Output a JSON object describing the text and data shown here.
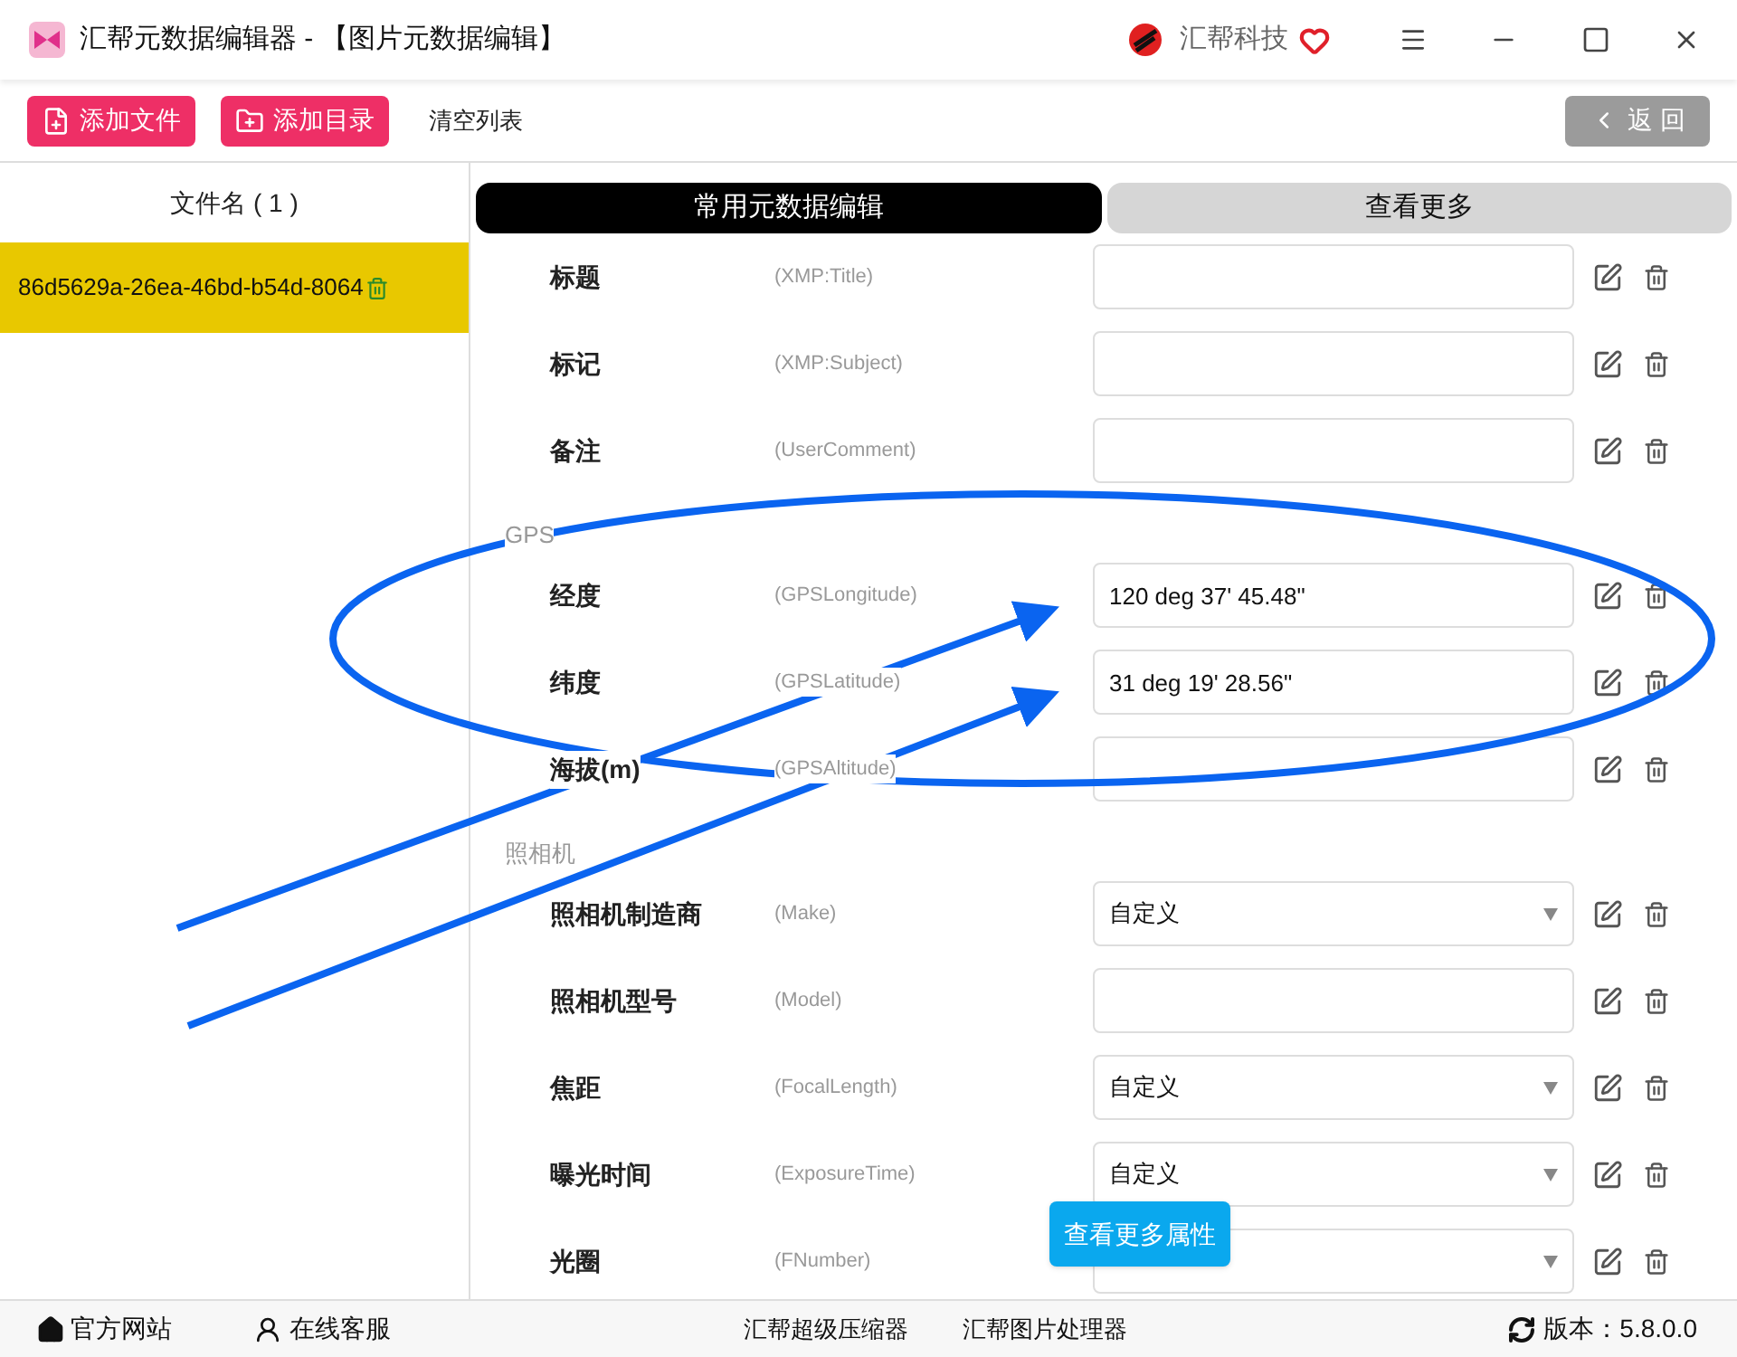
{
  "window": {
    "title": "汇帮元数据编辑器 - 【图片元数据编辑】",
    "brand": "汇帮科技"
  },
  "toolbar": {
    "buttons": [
      "添加文件",
      "添加目录"
    ],
    "clear": "清空列表",
    "back": "返 回"
  },
  "file_list": {
    "header": "文件名 ( 1 )",
    "files": [
      {
        "name": "86d5629a-26ea-46bd-b54d-8064",
        "selected": true
      }
    ]
  },
  "tabs": [
    {
      "label": "常用元数据编辑",
      "selected": true
    },
    {
      "label": "查看更多",
      "selected": false
    }
  ],
  "sections": [
    {
      "rows": [
        {
          "label": "标题",
          "tag": "(XMP:Title)",
          "kind": "text"
        },
        {
          "label": "标记",
          "tag": "(XMP:Subject)",
          "kind": "text"
        },
        {
          "label": "备注",
          "tag": "(UserComment)",
          "kind": "text"
        }
      ]
    },
    {
      "title": "GPS",
      "rows": [
        {
          "label": "经度",
          "tag": "(GPSLongitude)",
          "kind": "text",
          "value": "120 deg 37' 45.48\""
        },
        {
          "label": "纬度",
          "tag": "(GPSLatitude)",
          "kind": "text",
          "value": "31 deg 19' 28.56\""
        },
        {
          "label": "海拔(m)",
          "tag": "(GPSAltitude)",
          "kind": "text"
        }
      ]
    },
    {
      "title": "照相机",
      "rows": [
        {
          "label": "照相机制造商",
          "tag": "(Make)",
          "kind": "select",
          "value": "自定义"
        },
        {
          "label": "照相机型号",
          "tag": "(Model)",
          "kind": "text"
        },
        {
          "label": "焦距",
          "tag": "(FocalLength)",
          "kind": "select",
          "value": "自定义"
        },
        {
          "label": "曝光时间",
          "tag": "(ExposureTime)",
          "kind": "select",
          "value": "自定义"
        },
        {
          "label": "光圈",
          "tag": "(FNumber)",
          "kind": "select"
        }
      ]
    }
  ],
  "more_button": "查看更多属性",
  "status_bar": {
    "left": [
      "官方网站",
      "在线客服"
    ],
    "center": [
      "汇帮超级压缩器",
      "汇帮图片处理器"
    ],
    "version": "版本：5.8.0.0"
  }
}
